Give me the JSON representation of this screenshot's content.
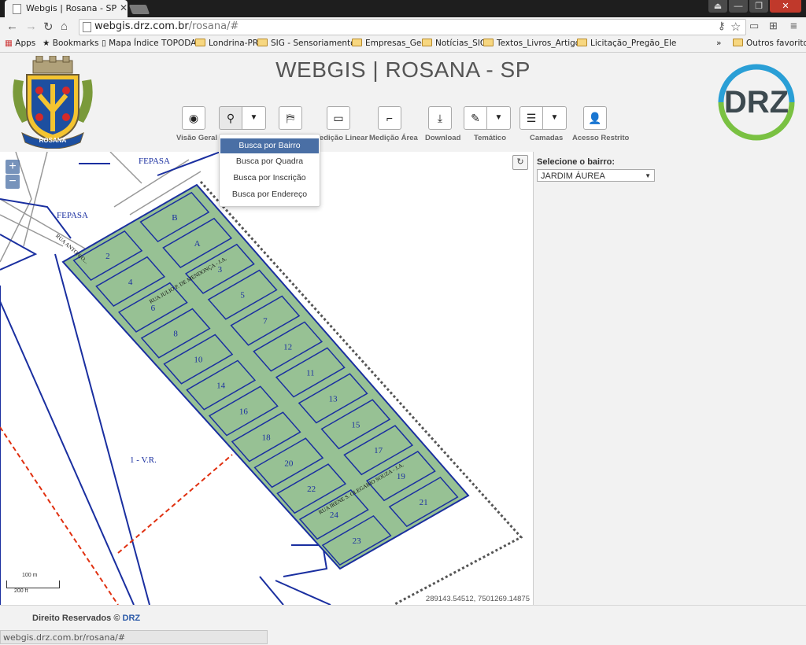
{
  "browser": {
    "tab_title": "Webgis | Rosana - SP",
    "tab_close": "✕",
    "url_host": "webgis.drz.com.br",
    "url_path": "/rosana/#",
    "window_buttons": [
      "⏏",
      "—",
      "❐",
      "✕"
    ],
    "bookmarks": [
      {
        "label": "Apps",
        "icon": "apps-grid-icon"
      },
      {
        "label": "Bookmarks",
        "icon": "star-icon"
      },
      {
        "label": "Mapa Índice TOPODA",
        "icon": "page-icon"
      },
      {
        "label": "Londrina-PR",
        "icon": "folder-icon"
      },
      {
        "label": "SIG - Sensoriamento",
        "icon": "folder-icon"
      },
      {
        "label": "Empresas_Geo",
        "icon": "folder-icon"
      },
      {
        "label": "Notícias_SIG",
        "icon": "folder-icon"
      },
      {
        "label": "Textos_Livros_Artigos",
        "icon": "folder-icon"
      },
      {
        "label": "Licitação_Pregão_Ele",
        "icon": "folder-icon"
      },
      {
        "label": "»",
        "icon": "overflow-icon"
      },
      {
        "label": "Outros favoritos",
        "icon": "folder-icon"
      }
    ],
    "status_url": "webgis.drz.com.br/rosana/#"
  },
  "header": {
    "title": "WEBGIS | ROSANA - SP",
    "coat_label": "ROSANA",
    "logo_text": "DRZ",
    "colors": {
      "drz_blue": "#2a9fd6",
      "drz_green": "#7ac142",
      "drz_dark": "#3d4a50"
    }
  },
  "tools": [
    {
      "label": "Visão Geral",
      "icon": "globe-icon"
    },
    {
      "label": "",
      "icon": "search-icon"
    },
    {
      "label": "",
      "icon": "layers-map-icon"
    },
    {
      "label": "Medição Linear",
      "icon": "ruler-icon"
    },
    {
      "label": "Medição Área",
      "icon": "area-icon"
    },
    {
      "label": "Download",
      "icon": "download-icon"
    },
    {
      "label": "Temático",
      "icon": "thematic-icon"
    },
    {
      "label": "Camadas",
      "icon": "layers-icon"
    },
    {
      "label": "Acesso Restrito",
      "icon": "user-icon"
    }
  ],
  "search_menu": {
    "items": [
      "Busca por Bairro",
      "Busca por Quadra",
      "Busca por Inscrição",
      "Busca por Endereço"
    ],
    "selected": "Busca por Bairro"
  },
  "map": {
    "labels": [
      "FEPASA",
      "FEPASA",
      "1 - V.R."
    ],
    "blocks": [
      "B",
      "2",
      "A",
      "4",
      "3",
      "6",
      "5",
      "8",
      "7",
      "10",
      "12",
      "14",
      "11",
      "16",
      "13",
      "18",
      "15",
      "20",
      "17",
      "22",
      "19",
      "24",
      "21",
      "23"
    ],
    "streets": [
      "RUA ANTONIO...",
      "RUA JULIO P. DE MENDONÇA - J.A.",
      "RUA IRENE S. OLEGARIO SOUZA - J.A."
    ],
    "coordinates": "289143.54512, 7501269.14875",
    "scale_m": "100 m",
    "scale_ft": "200 ft",
    "zoom_in": "+",
    "zoom_out": "−",
    "colors": {
      "block_fill": "#97c194",
      "block_stroke": "#1a2fa0",
      "boundary": "#555555",
      "road": "#1a2fa0",
      "dashed_red": "#e03010"
    }
  },
  "panel": {
    "label": "Selecione o bairro:",
    "selected_bairro": "JARDIM ÁUREA"
  },
  "footer": {
    "text": "Direito Reservados ©",
    "brand": "DRZ"
  }
}
